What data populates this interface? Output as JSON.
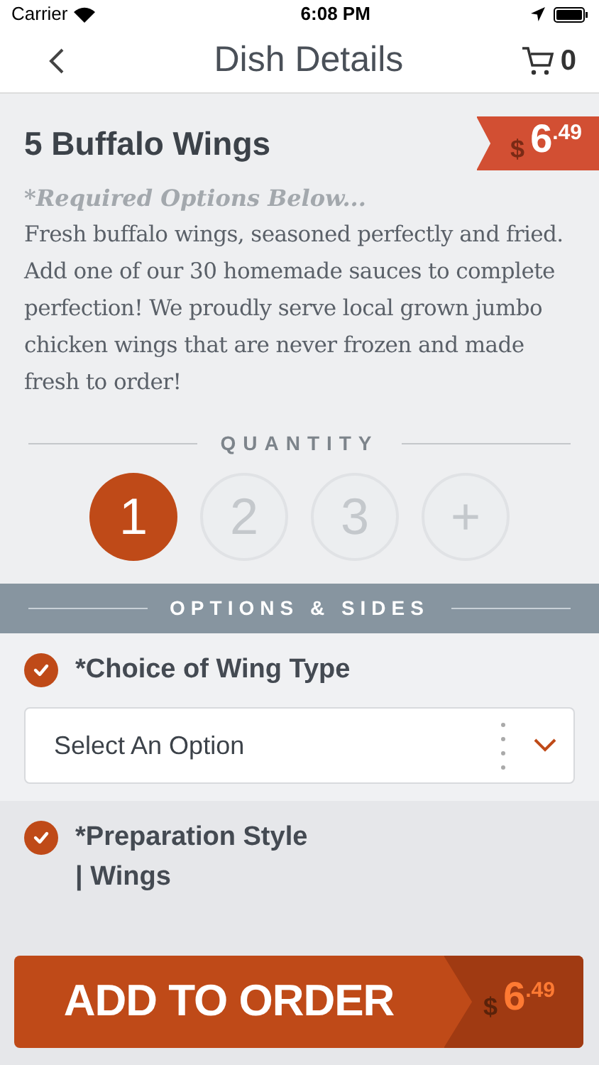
{
  "status_bar": {
    "carrier": "Carrier",
    "time": "6:08 PM"
  },
  "nav": {
    "title": "Dish Details",
    "cart_count": "0"
  },
  "dish": {
    "name": "5 Buffalo Wings",
    "price": {
      "currency": "$",
      "whole": "6",
      "cents": ".49"
    },
    "required_note": "*Required Options Below...",
    "description": "Fresh buffalo wings, seasoned perfectly and fried. Add one of our 30 homemade sauces to complete perfection! We proudly serve local grown jumbo chicken wings that are never frozen and made fresh to order!"
  },
  "quantity": {
    "label": "QUANTITY",
    "options": [
      {
        "label": "1",
        "selected": true
      },
      {
        "label": "2",
        "selected": false
      },
      {
        "label": "3",
        "selected": false
      },
      {
        "label": "+",
        "selected": false
      }
    ]
  },
  "options_header": "OPTIONS & SIDES",
  "options": [
    {
      "title": "*Choice of Wing Type",
      "checked": true,
      "select": {
        "placeholder": "Select An Option"
      }
    },
    {
      "title": "*Preparation Style\n| Wings",
      "checked": true
    }
  ],
  "add_button": {
    "label": "ADD TO ORDER",
    "price": {
      "currency": "$",
      "whole": "6",
      "cents": ".49"
    }
  }
}
